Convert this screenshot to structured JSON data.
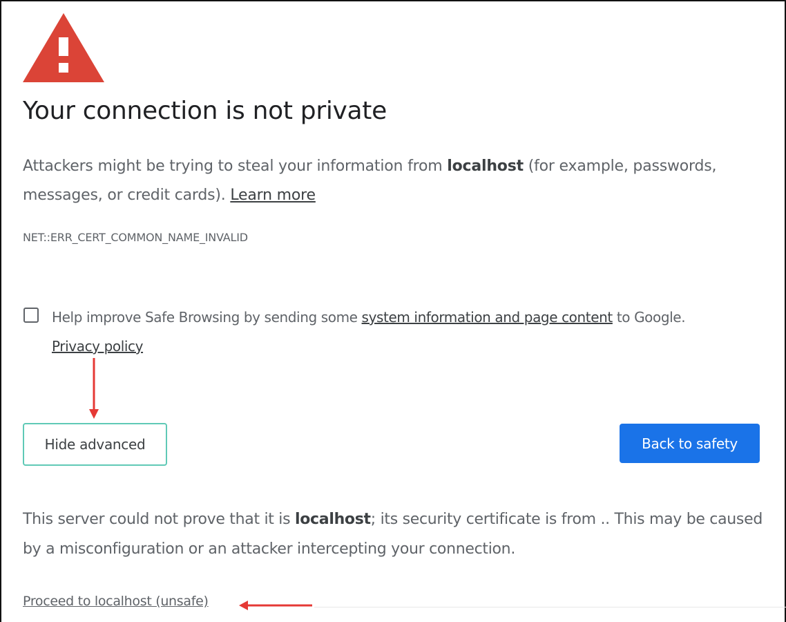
{
  "page": {
    "title": "Your connection is not private",
    "message": {
      "part1": "Attackers might be trying to steal your information from ",
      "host": "localhost",
      "part2": " (for example, passwords, messages, or credit cards). ",
      "learn_more": "Learn more"
    },
    "error_code": "NET::ERR_CERT_COMMON_NAME_INVALID"
  },
  "safe_browsing": {
    "text_before": "Help improve Safe Browsing by sending some ",
    "link_text": "system information and page content",
    "text_after": " to Google.",
    "privacy_policy": "Privacy policy",
    "checked": false
  },
  "buttons": {
    "hide_advanced": "Hide advanced",
    "back_to_safety": "Back to safety"
  },
  "details": {
    "part1": "This server could not prove that it is ",
    "host": "localhost",
    "part2": "; its security certificate is from .. This may be caused by a misconfiguration or an attacker intercepting your connection.",
    "proceed_link": "Proceed to localhost (unsafe)"
  },
  "colors": {
    "warning_red": "#db4437",
    "primary_blue": "#1a73e8",
    "focus_ring": "#5fc9b6",
    "annotation_red": "#e53935",
    "text_secondary": "#5f6368"
  },
  "icons": {
    "warning": "warning-triangle-icon",
    "checkbox": "checkbox-unchecked"
  }
}
